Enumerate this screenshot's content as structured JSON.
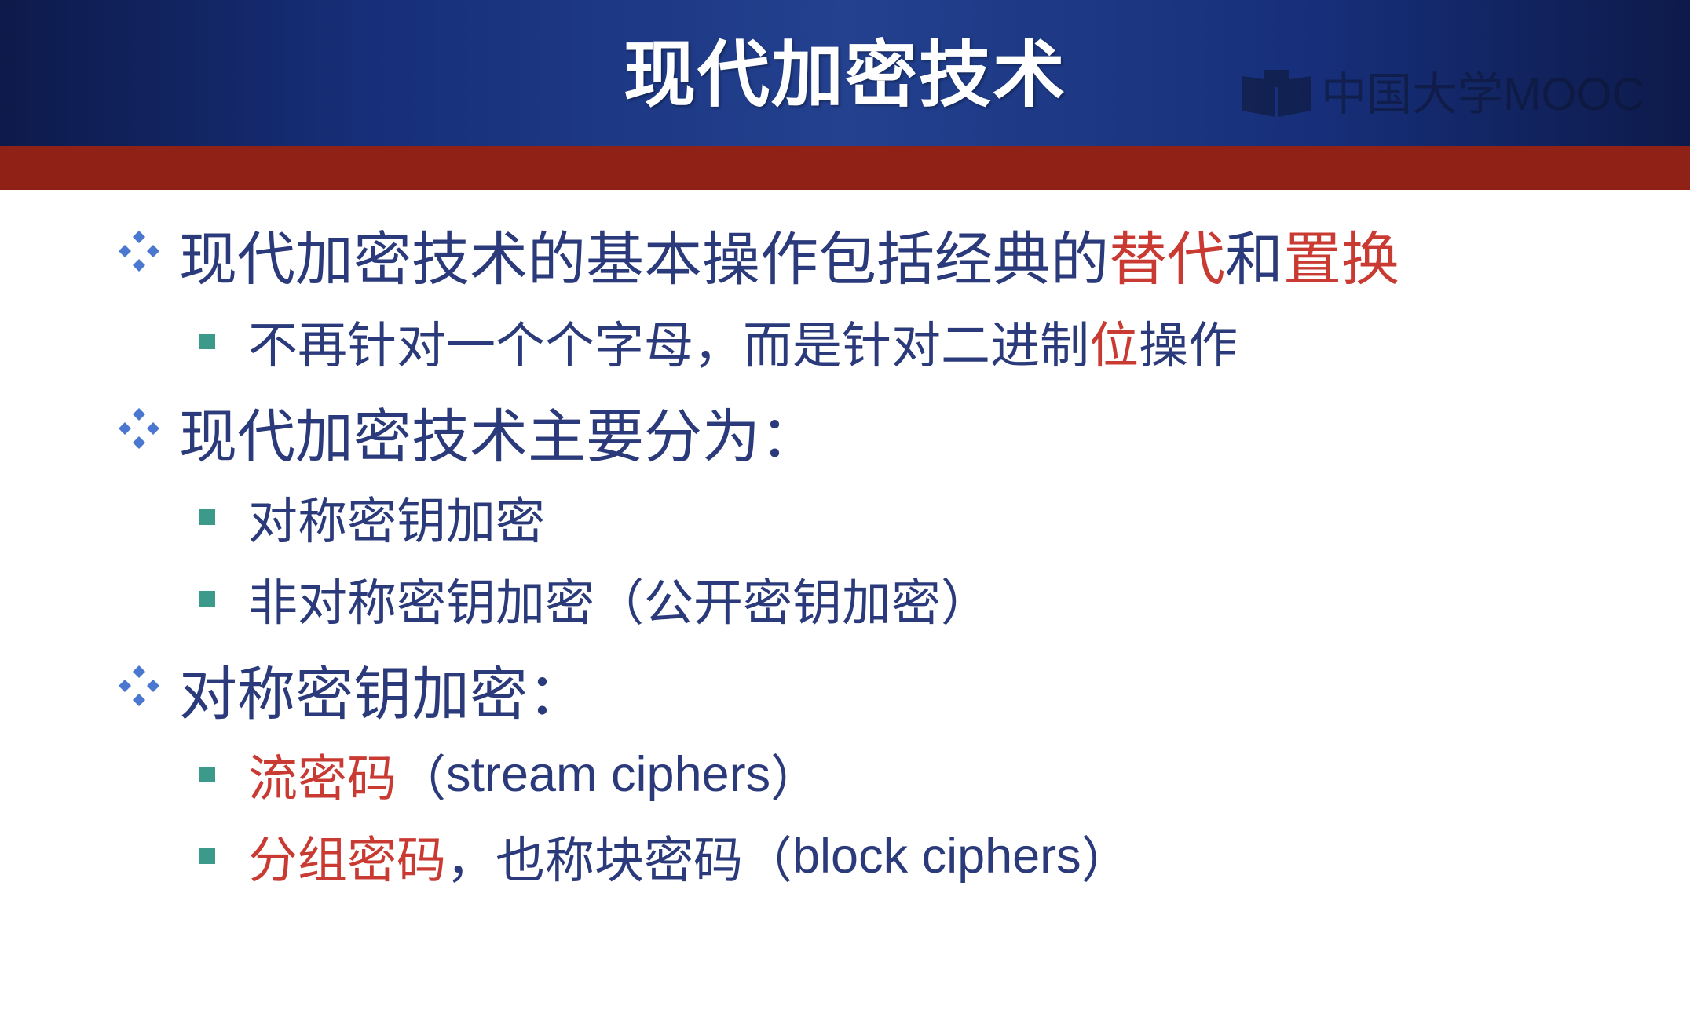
{
  "slide": {
    "title": "现代加密技术",
    "watermark": "中国大学MOOC"
  },
  "colors": {
    "header_blue": "#1c3a8a",
    "header_band_red": "#8f2116",
    "body_text": "#2b3a7a",
    "highlight_red": "#c93a33",
    "diamond_bullet": "#4a78d0",
    "square_bullet": "#3b9a8a"
  },
  "bullets": [
    {
      "level": 1,
      "icon": "diamond-bullet-icon",
      "segments": [
        {
          "text": "现代加密技术的基本操作包括经典的",
          "highlight": false
        },
        {
          "text": "替代",
          "highlight": true
        },
        {
          "text": "和",
          "highlight": false
        },
        {
          "text": "置换",
          "highlight": true
        }
      ]
    },
    {
      "level": 2,
      "icon": "square-bullet-icon",
      "segments": [
        {
          "text": "不再针对一个个字母，而是针对二进制",
          "highlight": false
        },
        {
          "text": "位",
          "highlight": true
        },
        {
          "text": "操作",
          "highlight": false
        }
      ]
    },
    {
      "level": 1,
      "icon": "diamond-bullet-icon",
      "segments": [
        {
          "text": "现代加密技术主要分为：",
          "highlight": false
        }
      ]
    },
    {
      "level": 2,
      "icon": "square-bullet-icon",
      "segments": [
        {
          "text": "对称密钥加密",
          "highlight": false
        }
      ]
    },
    {
      "level": 2,
      "icon": "square-bullet-icon",
      "segments": [
        {
          "text": "非对称密钥加密（公开密钥加密）",
          "highlight": false
        }
      ]
    },
    {
      "level": 1,
      "icon": "diamond-bullet-icon",
      "segments": [
        {
          "text": "对称密钥加密：",
          "highlight": false
        }
      ]
    },
    {
      "level": 2,
      "icon": "square-bullet-icon",
      "segments": [
        {
          "text": "流密码",
          "highlight": true
        },
        {
          "text": "（",
          "highlight": false
        },
        {
          "text": "stream ciphers",
          "highlight": false,
          "latin": true
        },
        {
          "text": "）",
          "highlight": false
        }
      ]
    },
    {
      "level": 2,
      "icon": "square-bullet-icon",
      "segments": [
        {
          "text": "分组密码",
          "highlight": true
        },
        {
          "text": "，也称块密码（",
          "highlight": false
        },
        {
          "text": "block ciphers",
          "highlight": false,
          "latin": true
        },
        {
          "text": "）",
          "highlight": false
        }
      ]
    }
  ]
}
